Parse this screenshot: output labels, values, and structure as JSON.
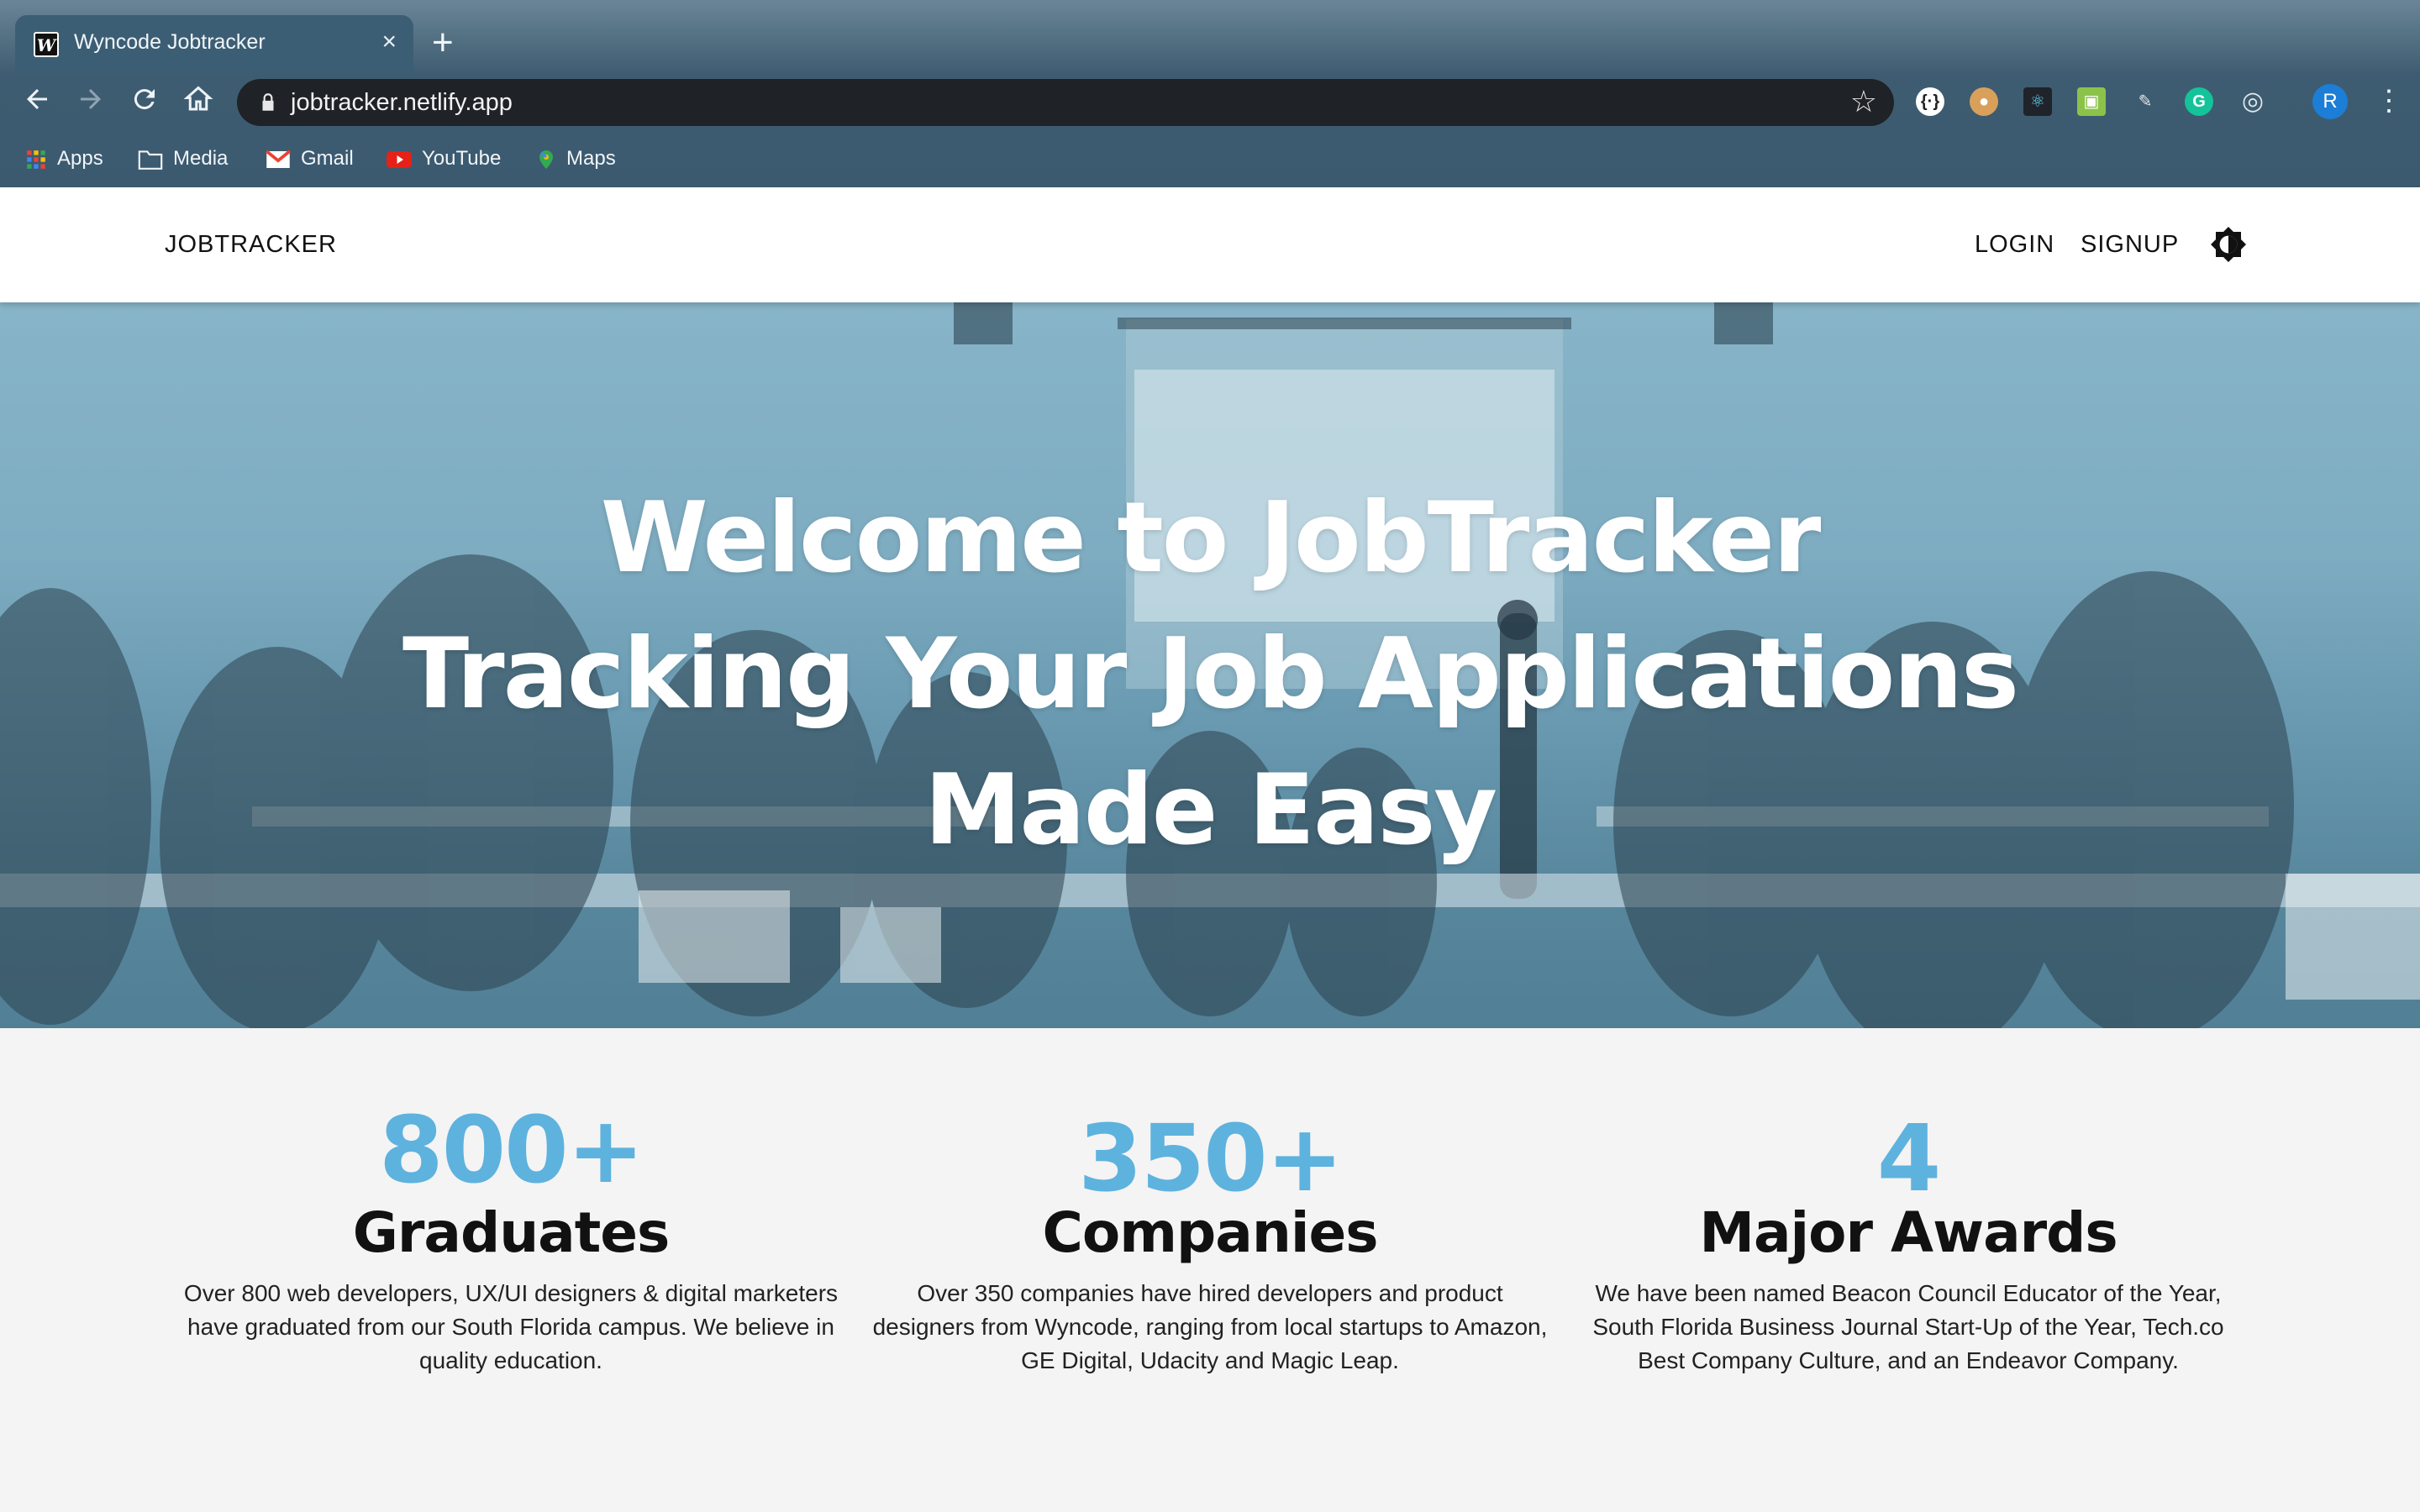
{
  "browser": {
    "tab_title": "Wyncode Jobtracker",
    "tab_close": "×",
    "new_tab": "+",
    "url": "jobtracker.netlify.app",
    "profile_initial": "R",
    "bookmarks": [
      {
        "label": "Apps",
        "icon": "apps-grid-icon"
      },
      {
        "label": "Media",
        "icon": "folder-icon"
      },
      {
        "label": "Gmail",
        "icon": "gmail-icon"
      },
      {
        "label": "YouTube",
        "icon": "youtube-icon"
      },
      {
        "label": "Maps",
        "icon": "maps-pin-icon"
      }
    ],
    "extensions": [
      "json-viewer-icon",
      "cookie-icon",
      "react-devtools-icon",
      "extension-shield-icon",
      "eyedropper-icon",
      "grammarly-icon",
      "target-icon"
    ]
  },
  "header": {
    "brand": "JOBTRACKER",
    "login": "LOGIN",
    "signup": "SIGNUP",
    "theme_icon": "brightness-toggle-icon"
  },
  "hero": {
    "line1": "Welcome to JobTracker",
    "line2": "Tracking Your Job Applications",
    "line3": "Made Easy"
  },
  "stats": [
    {
      "number": "800+",
      "title": "Graduates",
      "desc": "Over 800 web developers, UX/UI designers & digital marketers have graduated from our South Florida campus. We believe in quality education."
    },
    {
      "number": "350+",
      "title": "Companies",
      "desc": "Over 350 companies have hired developers and product designers from Wyncode, ranging from local startups to Amazon, GE Digital, Udacity and Magic Leap."
    },
    {
      "number": "4",
      "title": "Major Awards",
      "desc": "We have been named Beacon Council Educator of the Year, South Florida Business Journal Start-Up of the Year, Tech.co Best Company Culture, and an Endeavor Company."
    }
  ],
  "colors": {
    "accent": "#5eb2de",
    "chrome": "#3e5c71",
    "hero_overlay": "#6ea5be"
  }
}
